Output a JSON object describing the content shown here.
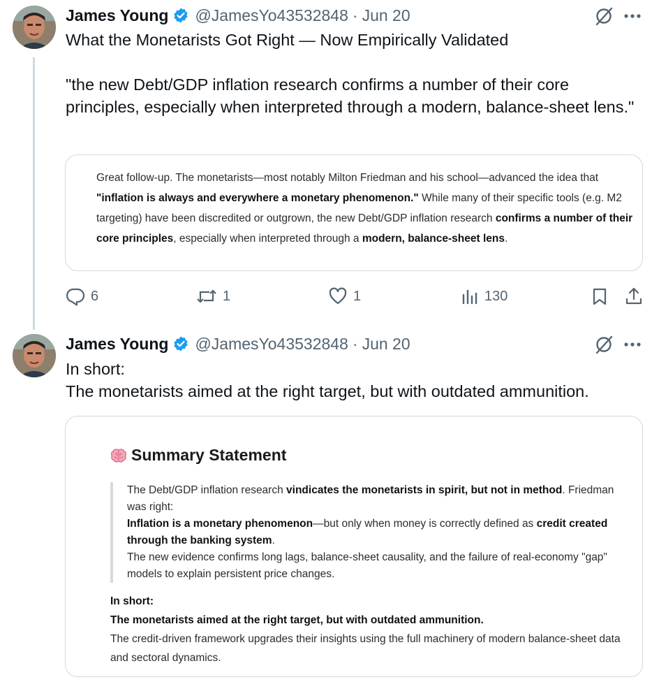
{
  "tweets": [
    {
      "author_name": "James Young",
      "handle": "@JamesYo43532848",
      "separator": "·",
      "date": "Jun 20",
      "text_lines": [
        "What the Monetarists Got Right — Now Empirically Validated",
        "\"the new Debt/GDP inflation research confirms a number of their core principles, especially when interpreted through a modern, balance-sheet lens.\""
      ],
      "card": {
        "t1": "Great follow-up. The monetarists—most notably Milton Friedman and his school—advanced the idea that ",
        "b1": "\"inflation is always and everywhere a monetary phenomenon.\"",
        "t2": " While many of their specific tools (e.g. M2 targeting) have been discredited or outgrown, the new Debt/GDP inflation research ",
        "b2": "confirms a number of their core principles",
        "t3": ", especially when interpreted through a ",
        "b3": "modern, balance-sheet lens",
        "t4": "."
      },
      "actions": {
        "replies": "6",
        "reposts": "1",
        "likes": "1",
        "views": "130"
      }
    },
    {
      "author_name": "James Young",
      "handle": "@JamesYo43532848",
      "separator": "·",
      "date": "Jun 20",
      "text_lines": [
        "In short:",
        "The monetarists aimed at the right target, but with outdated ammunition."
      ],
      "card": {
        "title": "Summary Statement",
        "q1_t1": "The Debt/GDP inflation research ",
        "q1_b1": "vindicates the monetarists in spirit, but not in method",
        "q1_t2": ". Friedman was right:",
        "q2_b1": "Inflation is a monetary phenomenon",
        "q2_t1": "—but only when money is correctly defined as ",
        "q2_b2": "credit created through the banking system",
        "q2_t2": ".",
        "q3": "The new evidence confirms long lags, balance-sheet causality, and the failure of real-economy \"gap\" models to explain persistent price changes.",
        "in_short": "In short:",
        "bold_line": "The monetarists aimed at the right target, but with outdated ammunition.",
        "last": "The credit-driven framework upgrades their insights using the full machinery of modern balance-sheet data and sectoral dynamics."
      }
    }
  ],
  "icons": {
    "verified": "verified-badge-icon",
    "grok": "grok-icon",
    "more": "more-icon",
    "reply": "reply-icon",
    "repost": "repost-icon",
    "like": "like-icon",
    "views": "views-icon",
    "bookmark": "bookmark-icon",
    "share": "share-icon",
    "brain": "brain-emoji-icon"
  },
  "colors": {
    "text": "#0f1419",
    "secondary": "#536471",
    "verified": "#1d9bf0",
    "border": "#cfd9de"
  }
}
